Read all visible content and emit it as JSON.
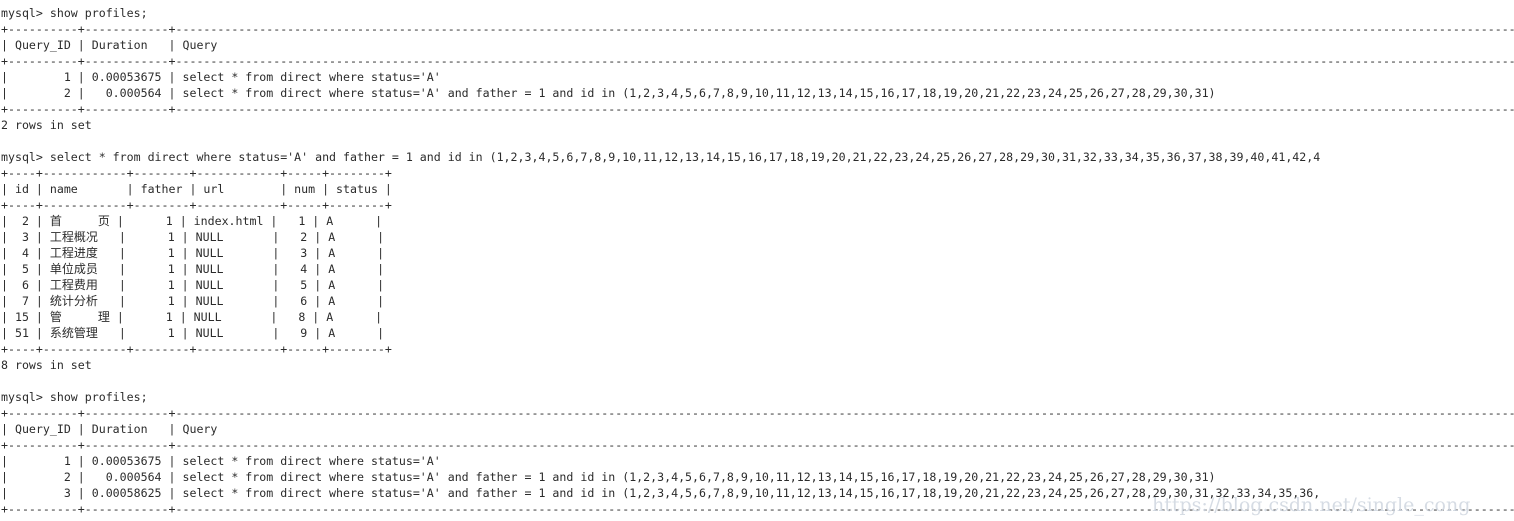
{
  "terminal": {
    "app": "mysql-client",
    "background_color": "#ffffff",
    "text_color": "#2b2b2b",
    "watermark": "https://blog.csdn.net/single_cong",
    "watermark_color": "#cfd6e0",
    "prompt": "mysql> ",
    "commands": [
      "show profiles;",
      "select * from direct where status='A' and father = 1 and id in (1,2,3,4,5,6,7,8,9,10,11,12,13,14,15,16,17,18,19,20,21,22,23,24,25,26,27,28,29,30,31,32,33,34,35,36,37,38,39,40,41,42,4",
      "show profiles;"
    ],
    "status_lines": [
      "2 rows in set",
      "8 rows in set"
    ],
    "profiles_first": {
      "columns": [
        "Query_ID",
        "Duration",
        "Query"
      ],
      "rows": [
        {
          "query_id": "1",
          "duration": "0.00053675",
          "query": "select * from direct where status='A'"
        },
        {
          "query_id": "2",
          "duration": "0.000564",
          "query": "select * from direct where status='A' and father = 1 and id in (1,2,3,4,5,6,7,8,9,10,11,12,13,14,15,16,17,18,19,20,21,22,23,24,25,26,27,28,29,30,31)"
        }
      ],
      "row_count_text": "2 rows in set"
    },
    "result_table": {
      "columns": [
        "id",
        "name",
        "father",
        "url",
        "num",
        "status"
      ],
      "rows": [
        {
          "id": "2",
          "name": "首　　　页",
          "father": "1",
          "url": "index.html",
          "num": "1",
          "status": "A"
        },
        {
          "id": "3",
          "name": "工程概况",
          "father": "1",
          "url": "NULL",
          "num": "2",
          "status": "A"
        },
        {
          "id": "4",
          "name": "工程进度",
          "father": "1",
          "url": "NULL",
          "num": "3",
          "status": "A"
        },
        {
          "id": "5",
          "name": "单位成员",
          "father": "1",
          "url": "NULL",
          "num": "4",
          "status": "A"
        },
        {
          "id": "6",
          "name": "工程费用",
          "father": "1",
          "url": "NULL",
          "num": "5",
          "status": "A"
        },
        {
          "id": "7",
          "name": "统计分析",
          "father": "1",
          "url": "NULL",
          "num": "6",
          "status": "A"
        },
        {
          "id": "15",
          "name": "管　　　理",
          "father": "1",
          "url": "NULL",
          "num": "8",
          "status": "A"
        },
        {
          "id": "51",
          "name": "系统管理",
          "father": "1",
          "url": "NULL",
          "num": "9",
          "status": "A"
        }
      ],
      "row_count_text": "8 rows in set"
    },
    "profiles_second": {
      "columns": [
        "Query_ID",
        "Duration",
        "Query"
      ],
      "rows": [
        {
          "query_id": "1",
          "duration": "0.00053675",
          "query": "select * from direct where status='A'"
        },
        {
          "query_id": "2",
          "duration": "0.000564",
          "query": "select * from direct where status='A' and father = 1 and id in (1,2,3,4,5,6,7,8,9,10,11,12,13,14,15,16,17,18,19,20,21,22,23,24,25,26,27,28,29,30,31)"
        },
        {
          "query_id": "3",
          "duration": "0.00058625",
          "query": "select * from direct where status='A' and father = 1 and id in (1,2,3,4,5,6,7,8,9,10,11,12,13,14,15,16,17,18,19,20,21,22,23,24,25,26,27,28,29,30,31,32,33,34,35,36,"
        }
      ]
    },
    "lines": [
      "mysql> show profiles;",
      "+----------+------------+------------------------------------------------------------------------------------------------------------------------------------------------------------------------------------------------------+",
      "| Query_ID | Duration   | Query                                                                                                                                                                                            |",
      "+----------+------------+------------------------------------------------------------------------------------------------------------------------------------------------------------------------------------------------------------------+",
      "|        1 | 0.00053675 | select * from direct where status='A'                                                                                                                                                            |",
      "|        2 |   0.000564 | select * from direct where status='A' and father = 1 and id in (1,2,3,4,5,6,7,8,9,10,11,12,13,14,15,16,17,18,19,20,21,22,23,24,25,26,27,28,29,30,31)                                              |",
      "+----------+------------+------------------------------------------------------------------------------------------------------------------------------------------------------------------------------------------------------------------+",
      "2 rows in set",
      "",
      "mysql> select * from direct where status='A' and father = 1 and id in (1,2,3,4,5,6,7,8,9,10,11,12,13,14,15,16,17,18,19,20,21,22,23,24,25,26,27,28,29,30,31,32,33,34,35,36,37,38,39,40,41,42,4",
      "+----+------------+--------+------------+-----+--------+",
      "| id | name       | father | url        | num | status |",
      "+----+------------+--------+------------+-----+--------+",
      "|  2 | 首　　　页 |      1 | index.html |   1 | A      |",
      "|  3 | 工程概况   |      1 | NULL       |   2 | A      |",
      "|  4 | 工程进度   |      1 | NULL       |   3 | A      |",
      "|  5 | 单位成员   |      1 | NULL       |   4 | A      |",
      "|  6 | 工程费用   |      1 | NULL       |   5 | A      |",
      "|  7 | 统计分析   |      1 | NULL       |   6 | A      |",
      "| 15 | 管　　　理 |      1 | NULL       |   8 | A      |",
      "| 51 | 系统管理   |      1 | NULL       |   9 | A      |",
      "+----+------------+--------+------------+-----+--------+",
      "8 rows in set",
      "",
      "mysql> show profiles;",
      "+----------+------------+------------------------------------------------------------------------------------------------------------------------------------------------------------------------------------------------------------------------------+",
      "| Query_ID | Duration   | Query                                                                                                                                                                                                                  |",
      "+----------+------------+------------------------------------------------------------------------------------------------------------------------------------------------------------------------------------------------------------------------------------+",
      "|        1 | 0.00053675 | select * from direct where status='A'                                                                                                                                                                                  |",
      "|        2 |   0.000564 | select * from direct where status='A' and father = 1 and id in (1,2,3,4,5,6,7,8,9,10,11,12,13,14,15,16,17,18,19,20,21,22,23,24,25,26,27,28,29,30,31)",
      "|        3 | 0.00058625 | select * from direct where status='A' and father = 1 and id in (1,2,3,4,5,6,7,8,9,10,11,12,13,14,15,16,17,18,19,20,21,22,23,24,25,26,27,28,29,30,31,32,33,34,35,36,",
      "+----------+------------+------------------------------------------------------------------------------------------------------------------------------------------------------------------------------------------------------------------------------------+"
    ]
  }
}
